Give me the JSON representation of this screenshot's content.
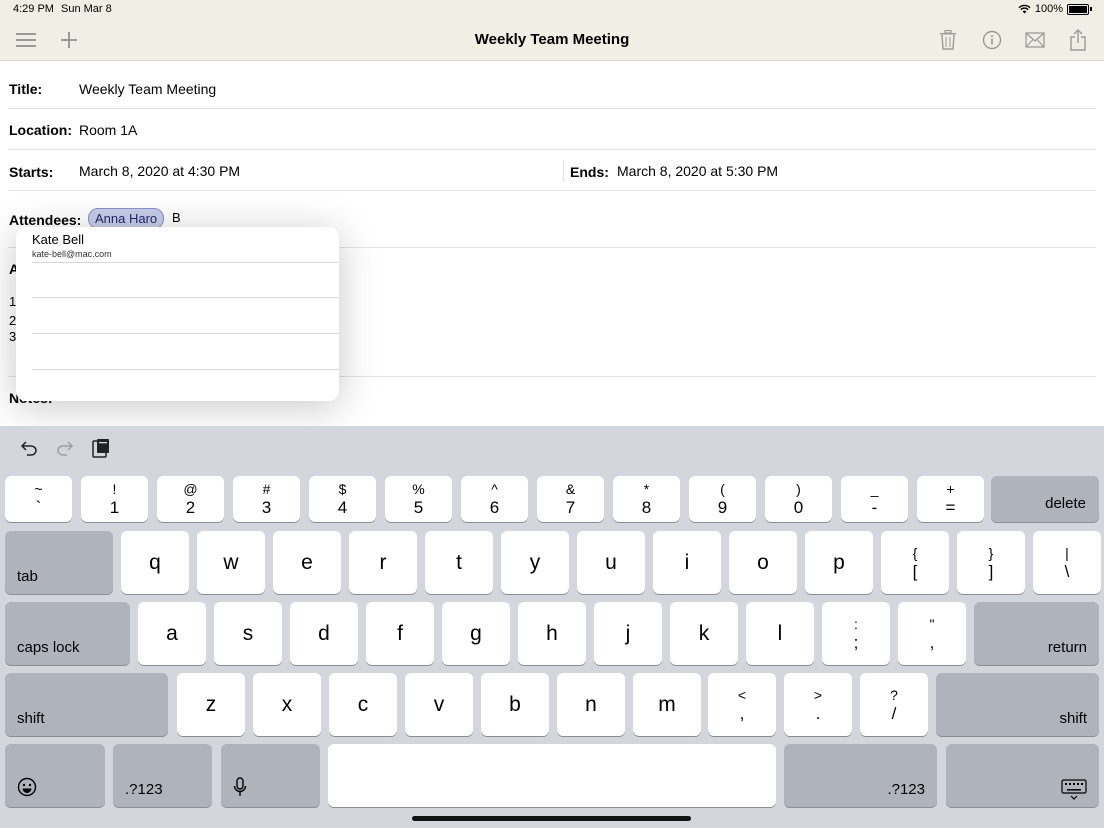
{
  "status_bar": {
    "time": "4:29 PM",
    "date": "Sun Mar 8",
    "battery": "100%"
  },
  "nav": {
    "title": "Weekly Team Meeting",
    "icons": [
      "menu-icon",
      "plus-icon",
      "trash-icon",
      "info-icon",
      "mail-icon",
      "share-icon"
    ]
  },
  "form": {
    "title_label": "Title:",
    "title_value": "Weekly Team Meeting",
    "location_label": "Location:",
    "location_value": "Room 1A",
    "starts_label": "Starts:",
    "starts_value": "March 8, 2020 at 4:30 PM",
    "ends_label": "Ends:",
    "ends_value": "March 8, 2020 at 5:30 PM",
    "attendees_label": "Attendees:",
    "attendee_chip": "Anna Haro",
    "attendee_typing": "B",
    "partial_label_a": "A",
    "partial_label_1": "1",
    "partial_label_2": "2",
    "partial_label_3": "3",
    "notes_label": "Notes:"
  },
  "suggestions": {
    "name": "Kate Bell",
    "email": "kate-bell@mac.com"
  },
  "keyboard": {
    "row1": [
      {
        "top": "~",
        "bot": "`"
      },
      {
        "top": "!",
        "bot": "1"
      },
      {
        "top": "@",
        "bot": "2"
      },
      {
        "top": "#",
        "bot": "3"
      },
      {
        "top": "$",
        "bot": "4"
      },
      {
        "top": "%",
        "bot": "5"
      },
      {
        "top": "^",
        "bot": "6"
      },
      {
        "top": "&",
        "bot": "7"
      },
      {
        "top": "*",
        "bot": "8"
      },
      {
        "top": "(",
        "bot": "9"
      },
      {
        "top": ")",
        "bot": "0"
      },
      {
        "top": "_",
        "bot": "-"
      },
      {
        "top": "+",
        "bot": "="
      }
    ],
    "delete": "delete",
    "tab": "tab",
    "row2": [
      "q",
      "w",
      "e",
      "r",
      "t",
      "y",
      "u",
      "i",
      "o",
      "p"
    ],
    "row2_sym": [
      {
        "top": "{",
        "bot": "["
      },
      {
        "top": "}",
        "bot": "]"
      },
      {
        "top": "|",
        "bot": "\\"
      }
    ],
    "caps_lock": "caps lock",
    "row3": [
      "a",
      "s",
      "d",
      "f",
      "g",
      "h",
      "j",
      "k",
      "l"
    ],
    "row3_sym": [
      {
        "top": ":",
        "bot": ";"
      },
      {
        "top": "\"",
        "bot": ","
      }
    ],
    "return": "return",
    "shift": "shift",
    "row4": [
      "z",
      "x",
      "c",
      "v",
      "b",
      "n",
      "m"
    ],
    "row4_sym": [
      {
        "top": "<",
        "bot": ","
      },
      {
        "top": ">",
        "bot": "."
      },
      {
        "top": "?",
        "bot": "/"
      }
    ],
    "numbers": ".?123"
  }
}
